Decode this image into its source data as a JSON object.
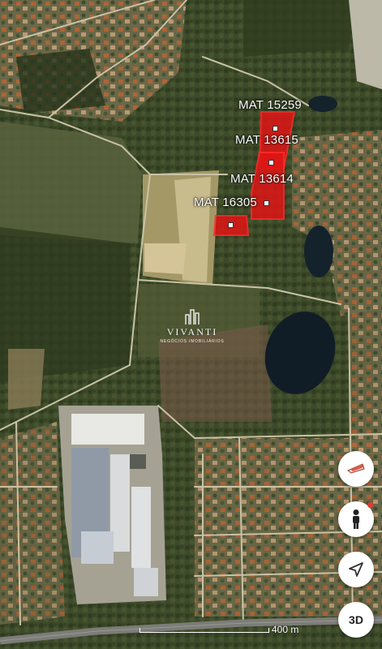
{
  "parcels": [
    {
      "label": "MAT 15259"
    },
    {
      "label": "MAT 13615"
    },
    {
      "label": "MAT 13614"
    },
    {
      "label": "MAT 16305"
    }
  ],
  "watermark": {
    "brand": "VIVANTI",
    "tagline": "NEGÓCIOS IMOBILIÁRIOS"
  },
  "controls": {
    "layers_icon": "layers-icon",
    "street_view_icon": "pegman-icon",
    "location_icon": "navigation-arrow-icon",
    "three_d_label": "3D"
  },
  "scale": {
    "label": "400 m"
  },
  "colors": {
    "parcel_highlight": "#e01515",
    "red_dot": "#e53935"
  }
}
